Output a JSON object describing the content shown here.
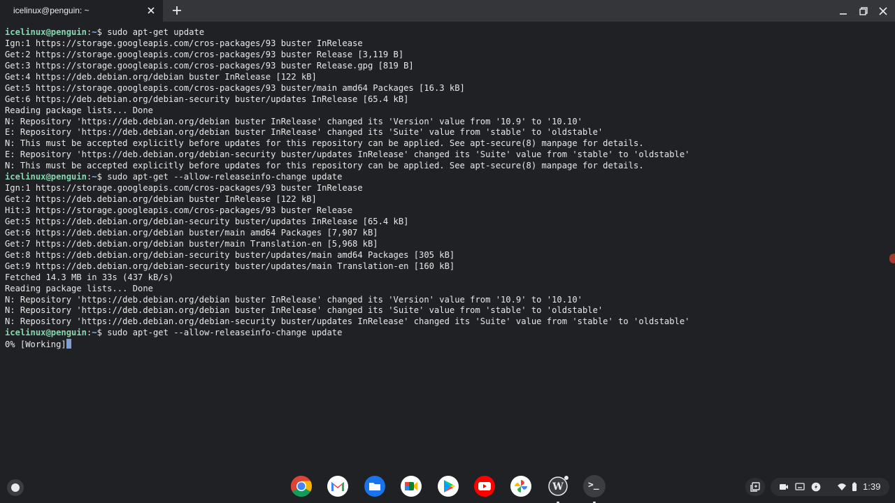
{
  "window": {
    "tab_title": "icelinux@penguin: ~",
    "tab_close_icon": "close-icon",
    "new_tab_icon": "plus-icon",
    "controls": [
      "minimize-icon",
      "maximize-icon",
      "close-icon"
    ]
  },
  "terminal": {
    "prompt_user": "icelinux@penguin",
    "prompt_path": "~",
    "lines": [
      {
        "type": "prompt",
        "cmd": "$ sudo apt-get update"
      },
      {
        "type": "out",
        "text": "Ign:1 https://storage.googleapis.com/cros-packages/93 buster InRelease"
      },
      {
        "type": "out",
        "text": "Get:2 https://storage.googleapis.com/cros-packages/93 buster Release [3,119 B]"
      },
      {
        "type": "out",
        "text": "Get:3 https://storage.googleapis.com/cros-packages/93 buster Release.gpg [819 B]"
      },
      {
        "type": "out",
        "text": "Get:4 https://deb.debian.org/debian buster InRelease [122 kB]"
      },
      {
        "type": "out",
        "text": "Get:5 https://storage.googleapis.com/cros-packages/93 buster/main amd64 Packages [16.3 kB]"
      },
      {
        "type": "out",
        "text": "Get:6 https://deb.debian.org/debian-security buster/updates InRelease [65.4 kB]"
      },
      {
        "type": "out",
        "text": "Reading package lists... Done"
      },
      {
        "type": "out",
        "text": "N: Repository 'https://deb.debian.org/debian buster InRelease' changed its 'Version' value from '10.9' to '10.10'"
      },
      {
        "type": "out",
        "text": "E: Repository 'https://deb.debian.org/debian buster InRelease' changed its 'Suite' value from 'stable' to 'oldstable'"
      },
      {
        "type": "out",
        "text": "N: This must be accepted explicitly before updates for this repository can be applied. See apt-secure(8) manpage for details."
      },
      {
        "type": "out",
        "text": "E: Repository 'https://deb.debian.org/debian-security buster/updates InRelease' changed its 'Suite' value from 'stable' to 'oldstable'"
      },
      {
        "type": "out",
        "text": "N: This must be accepted explicitly before updates for this repository can be applied. See apt-secure(8) manpage for details."
      },
      {
        "type": "prompt",
        "cmd": "$ sudo apt-get --allow-releaseinfo-change update"
      },
      {
        "type": "out",
        "text": "Ign:1 https://storage.googleapis.com/cros-packages/93 buster InRelease"
      },
      {
        "type": "out",
        "text": "Get:2 https://deb.debian.org/debian buster InRelease [122 kB]"
      },
      {
        "type": "out",
        "text": "Hit:3 https://storage.googleapis.com/cros-packages/93 buster Release"
      },
      {
        "type": "out",
        "text": "Get:5 https://deb.debian.org/debian-security buster/updates InRelease [65.4 kB]"
      },
      {
        "type": "out",
        "text": "Get:6 https://deb.debian.org/debian buster/main amd64 Packages [7,907 kB]"
      },
      {
        "type": "out",
        "text": "Get:7 https://deb.debian.org/debian buster/main Translation-en [5,968 kB]"
      },
      {
        "type": "out",
        "text": "Get:8 https://deb.debian.org/debian-security buster/updates/main amd64 Packages [305 kB]"
      },
      {
        "type": "out",
        "text": "Get:9 https://deb.debian.org/debian-security buster/updates/main Translation-en [160 kB]"
      },
      {
        "type": "out",
        "text": "Fetched 14.3 MB in 33s (437 kB/s)"
      },
      {
        "type": "out",
        "text": "Reading package lists... Done"
      },
      {
        "type": "out",
        "text": "N: Repository 'https://deb.debian.org/debian buster InRelease' changed its 'Version' value from '10.9' to '10.10'"
      },
      {
        "type": "out",
        "text": "N: Repository 'https://deb.debian.org/debian buster InRelease' changed its 'Suite' value from 'stable' to 'oldstable'"
      },
      {
        "type": "out",
        "text": "N: Repository 'https://deb.debian.org/debian-security buster/updates InRelease' changed its 'Suite' value from 'stable' to 'oldstable'"
      },
      {
        "type": "prompt",
        "cmd": "$ sudo apt-get --allow-releaseinfo-change update"
      },
      {
        "type": "out",
        "text": "0% [Working]",
        "cursor": true
      }
    ]
  },
  "shelf": {
    "launcher_icon": "launcher-icon",
    "apps": [
      {
        "name": "chrome-icon"
      },
      {
        "name": "gmail-icon"
      },
      {
        "name": "files-icon"
      },
      {
        "name": "google-meet-icon"
      },
      {
        "name": "play-store-icon"
      },
      {
        "name": "youtube-icon"
      },
      {
        "name": "google-photos-icon"
      },
      {
        "name": "wordpress-icon"
      },
      {
        "name": "terminal-icon",
        "glyph": ">_"
      }
    ],
    "tray": {
      "icons": [
        "holding-space-icon",
        "screen-capture-icon",
        "cast-icon",
        "notification-icon",
        "wifi-icon",
        "battery-icon"
      ],
      "time": "1:39"
    },
    "colors": {
      "accent": "#8ab4f8",
      "prompt_user": "#87d7af",
      "background": "#202124"
    }
  }
}
